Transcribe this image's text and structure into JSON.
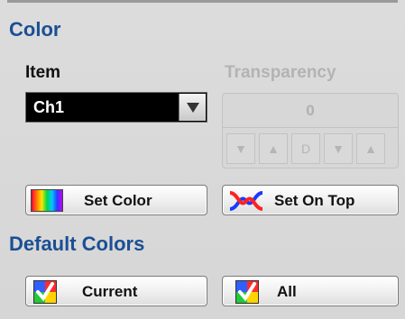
{
  "color_section": {
    "title": "Color",
    "item_label": "Item",
    "item_value": "Ch1",
    "transparency_label": "Transparency",
    "transparency_value": "0",
    "transparency_buttons": [
      "▼",
      "▲",
      "D",
      "▼",
      "▲"
    ]
  },
  "buttons": {
    "set_color": "Set Color",
    "set_on_top": "Set On Top"
  },
  "default_colors": {
    "title": "Default Colors",
    "current": "Current",
    "all": "All"
  },
  "colors": {
    "section_title": "#1b4f94",
    "dropdown_bg": "#000000",
    "disabled_text": "#b3b3b3"
  },
  "icons": {
    "set_color": "rainbow-swatch-icon",
    "set_on_top": "crossed-waves-icon",
    "default_colors": "color-check-icon"
  }
}
